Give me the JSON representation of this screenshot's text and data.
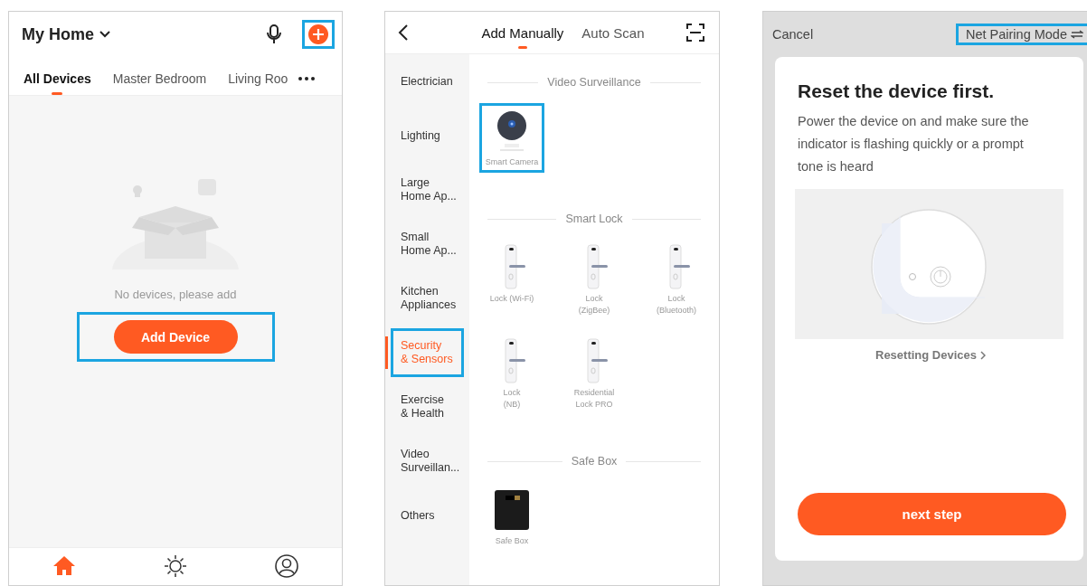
{
  "screens": [
    {
      "kind": "home",
      "title": "My Home",
      "add_icon": {
        "highlighted": true
      },
      "rooms": [
        {
          "label": "All Devices",
          "selected": true
        },
        {
          "label": "Master Bedroom",
          "selected": false
        },
        {
          "label": "Living Roo",
          "selected": false
        }
      ],
      "empty_message": "No devices, please add",
      "add_button": {
        "label": "Add Device",
        "highlighted": true
      },
      "nav": [
        {
          "kind": "home",
          "selected": true
        },
        {
          "kind": "sun",
          "selected": false
        },
        {
          "kind": "person",
          "selected": false
        }
      ]
    },
    {
      "kind": "add",
      "tabs": [
        {
          "label": "Add Manually",
          "selected": true
        },
        {
          "label": "Auto Scan",
          "selected": false
        }
      ],
      "categories": [
        {
          "label": "Electrician",
          "selected": false,
          "highlighted": false
        },
        {
          "label": "Lighting",
          "selected": false,
          "highlighted": false
        },
        {
          "label": "Large\nHome Ap...",
          "selected": false,
          "highlighted": false
        },
        {
          "label": "Small\nHome Ap...",
          "selected": false,
          "highlighted": false
        },
        {
          "label": "Kitchen\nAppliances",
          "selected": false,
          "highlighted": false
        },
        {
          "label": "Security\n& Sensors",
          "selected": true,
          "highlighted": true
        },
        {
          "label": "Exercise\n& Health",
          "selected": false,
          "highlighted": false
        },
        {
          "label": "Video\nSurveillan...",
          "selected": false,
          "highlighted": false
        },
        {
          "label": "Others",
          "selected": false,
          "highlighted": false
        }
      ],
      "sections": [
        {
          "title": "Video Surveillance",
          "devices": [
            {
              "name": "Smart Camera",
              "kind": "camera",
              "highlighted": true
            }
          ]
        },
        {
          "title": "Smart Lock",
          "devices": [
            {
              "name": "Lock (Wi-Fi)",
              "kind": "lock",
              "highlighted": false
            },
            {
              "name": "Lock\n(ZigBee)",
              "kind": "lock",
              "highlighted": false
            },
            {
              "name": "Lock\n(Bluetooth)",
              "kind": "lock",
              "highlighted": false
            },
            {
              "name": "Lock\n(NB)",
              "kind": "lock",
              "highlighted": false
            },
            {
              "name": "Residential\nLock PRO",
              "kind": "lock",
              "highlighted": false
            }
          ]
        },
        {
          "title": "Safe Box",
          "devices": [
            {
              "name": "Safe Box",
              "kind": "safe",
              "highlighted": false
            }
          ]
        }
      ]
    },
    {
      "kind": "reset",
      "cancel": "Cancel",
      "mode": {
        "label": "Net Pairing Mode",
        "highlighted": true
      },
      "title": "Reset the device first.",
      "body": "Power the device on and make sure the indicator is flashing quickly or a prompt tone is heard",
      "link": "Resetting Devices",
      "button": "next step"
    }
  ]
}
